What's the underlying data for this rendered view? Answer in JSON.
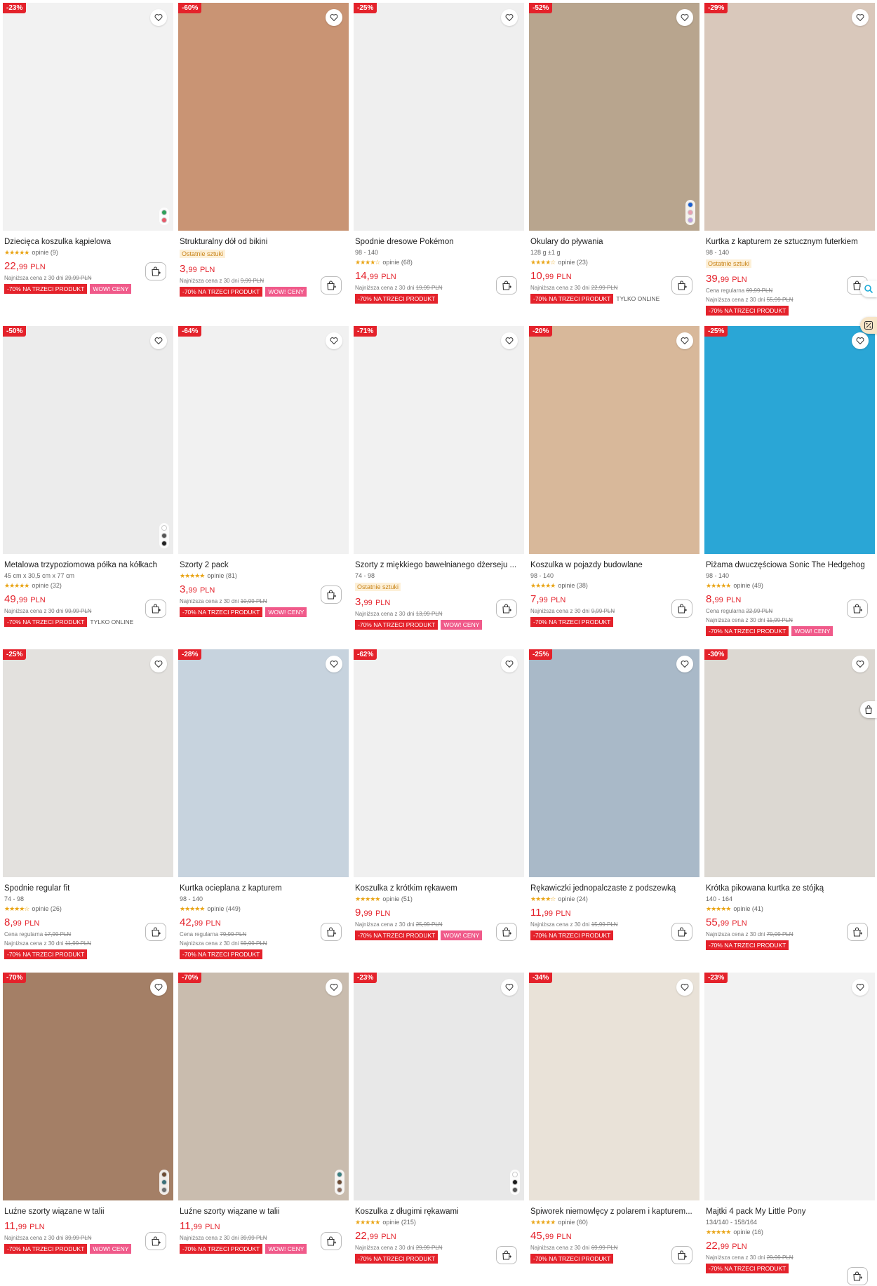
{
  "products": [
    {
      "discount": "-23%",
      "title": "Dziecięca koszulka kąpielowa",
      "sub": "",
      "stars": "★★★★★",
      "reviews": "opinie (9)",
      "last": "",
      "price_main": "22,",
      "price_dec": "99",
      "price_cur": "PLN",
      "reg": "",
      "reg_old": "",
      "low": "Najniższa cena z 30 dni",
      "low_old": "29,99 PLN",
      "badge1": "-70% NA TRZECI PRODUKT",
      "badge2": "WOW! CENY",
      "badge2_type": "pink",
      "bg": "#f2f2f2",
      "swatches": [
        "#2ea05a",
        "#e85a6a"
      ]
    },
    {
      "discount": "-60%",
      "title": "Strukturalny dół od bikini",
      "sub": "",
      "stars": "",
      "reviews": "",
      "last": "Ostatnie sztuki",
      "price_main": "3,",
      "price_dec": "99",
      "price_cur": "PLN",
      "reg": "",
      "reg_old": "",
      "low": "Najniższa cena z 30 dni",
      "low_old": "9,99 PLN",
      "badge1": "-70% NA TRZECI PRODUKT",
      "badge2": "WOW! CENY",
      "badge2_type": "pink",
      "bg": "#c99474",
      "swatches": []
    },
    {
      "discount": "-25%",
      "title": "Spodnie dresowe Pokémon",
      "sub": "98 - 140",
      "stars": "★★★★☆",
      "reviews": "opinie (68)",
      "last": "",
      "price_main": "14,",
      "price_dec": "99",
      "price_cur": "PLN",
      "reg": "",
      "reg_old": "",
      "low": "Najniższa cena z 30 dni",
      "low_old": "19,99 PLN",
      "badge1": "-70% NA TRZECI PRODUKT",
      "badge2": "",
      "badge2_type": "",
      "bg": "#efefef",
      "swatches": []
    },
    {
      "discount": "-52%",
      "title": "Okulary do pływania",
      "sub": "128 g ±1 g",
      "stars": "★★★★☆",
      "reviews": "opinie (23)",
      "last": "",
      "price_main": "10,",
      "price_dec": "99",
      "price_cur": "PLN",
      "reg": "",
      "reg_old": "",
      "low": "Najniższa cena z 30 dni",
      "low_old": "22,99 PLN",
      "badge1": "-70% NA TRZECI PRODUKT",
      "badge2": "TYLKO ONLINE",
      "badge2_type": "text",
      "bg": "#b8a58e",
      "swatches": [
        "#1a5fd0",
        "#e8a0b0",
        "#c0a0e0"
      ]
    },
    {
      "discount": "-29%",
      "title": "Kurtka z kapturem ze sztucznym futerkiem",
      "sub": "98 - 140",
      "stars": "",
      "reviews": "",
      "last": "Ostatnie sztuki",
      "price_main": "39,",
      "price_dec": "99",
      "price_cur": "PLN",
      "reg": "Cena regularna",
      "reg_old": "69,99 PLN",
      "low": "Najniższa cena z 30 dni",
      "low_old": "55,99 PLN",
      "badge1": "-70% NA TRZECI PRODUKT",
      "badge2": "",
      "badge2_type": "",
      "bg": "#d9c8bb",
      "swatches": []
    },
    {
      "discount": "-50%",
      "title": "Metalowa trzypoziomowa półka na kółkach",
      "sub": "45 cm x 30,5 cm x 77 cm",
      "stars": "★★★★★",
      "reviews": "opinie (32)",
      "last": "",
      "price_main": "49,",
      "price_dec": "99",
      "price_cur": "PLN",
      "reg": "",
      "reg_old": "",
      "low": "Najniższa cena z 30 dni",
      "low_old": "99,99 PLN",
      "badge1": "-70% NA TRZECI PRODUKT",
      "badge2": "TYLKO ONLINE",
      "badge2_type": "text",
      "bg": "#ececec",
      "swatches": [
        "#ffffff",
        "#555555",
        "#222222"
      ]
    },
    {
      "discount": "-64%",
      "title": "Szorty 2 pack",
      "sub": "",
      "stars": "★★★★★",
      "reviews": "opinie (81)",
      "last": "",
      "price_main": "3,",
      "price_dec": "99",
      "price_cur": "PLN",
      "reg": "",
      "reg_old": "",
      "low": "Najniższa cena z 30 dni",
      "low_old": "10,99 PLN",
      "badge1": "-70% NA TRZECI PRODUKT",
      "badge2": "WOW! CENY",
      "badge2_type": "pink",
      "bg": "#f1f1f1",
      "swatches": []
    },
    {
      "discount": "-71%",
      "title": "Szorty z miękkiego bawełnianego dżerseju ...",
      "sub": "74 - 98",
      "stars": "",
      "reviews": "",
      "last": "Ostatnie sztuki",
      "price_main": "3,",
      "price_dec": "99",
      "price_cur": "PLN",
      "reg": "",
      "reg_old": "",
      "low": "Najniższa cena z 30 dni",
      "low_old": "13,99 PLN",
      "badge1": "-70% NA TRZECI PRODUKT",
      "badge2": "WOW! CENY",
      "badge2_type": "pink",
      "bg": "#f1f1f1",
      "swatches": []
    },
    {
      "discount": "-20%",
      "title": "Koszulka w pojazdy budowlane",
      "sub": "98 - 140",
      "stars": "★★★★★",
      "reviews": "opinie (38)",
      "last": "",
      "price_main": "7,",
      "price_dec": "99",
      "price_cur": "PLN",
      "reg": "",
      "reg_old": "",
      "low": "Najniższa cena z 30 dni",
      "low_old": "9,99 PLN",
      "badge1": "-70% NA TRZECI PRODUKT",
      "badge2": "",
      "badge2_type": "",
      "bg": "#d8b89a",
      "swatches": []
    },
    {
      "discount": "-25%",
      "title": "Piżama dwuczęściowa Sonic The Hedgehog",
      "sub": "98 - 140",
      "stars": "★★★★★",
      "reviews": "opinie (49)",
      "last": "",
      "price_main": "8,",
      "price_dec": "99",
      "price_cur": "PLN",
      "reg": "Cena regularna",
      "reg_old": "22,99 PLN",
      "low": "Najniższa cena z 30 dni",
      "low_old": "11,99 PLN",
      "badge1": "-70% NA TRZECI PRODUKT",
      "badge2": "WOW! CENY",
      "badge2_type": "pink",
      "bg": "#2aa6d6",
      "swatches": []
    },
    {
      "discount": "-25%",
      "title": "Spodnie regular fit",
      "sub": "74 - 98",
      "stars": "★★★★☆",
      "reviews": "opinie (26)",
      "last": "",
      "price_main": "8,",
      "price_dec": "99",
      "price_cur": "PLN",
      "reg": "Cena regularna",
      "reg_old": "17,99 PLN",
      "low": "Najniższa cena z 30 dni",
      "low_old": "11,99 PLN",
      "badge1": "-70% NA TRZECI PRODUKT",
      "badge2": "",
      "badge2_type": "",
      "bg": "#e3e1de",
      "swatches": []
    },
    {
      "discount": "-28%",
      "title": "Kurtka ocieplana z kapturem",
      "sub": "98 - 140",
      "stars": "★★★★★",
      "reviews": "opinie (449)",
      "last": "",
      "price_main": "42,",
      "price_dec": "99",
      "price_cur": "PLN",
      "reg": "Cena regularna",
      "reg_old": "79,99 PLN",
      "low": "Najniższa cena z 30 dni",
      "low_old": "59,99 PLN",
      "badge1": "-70% NA TRZECI PRODUKT",
      "badge2": "",
      "badge2_type": "",
      "bg": "#c7d3de",
      "swatches": []
    },
    {
      "discount": "-62%",
      "title": "Koszulka z krótkim rękawem",
      "sub": "",
      "stars": "★★★★★",
      "reviews": "opinie (51)",
      "last": "",
      "price_main": "9,",
      "price_dec": "99",
      "price_cur": "PLN",
      "reg": "",
      "reg_old": "",
      "low": "Najniższa cena z 30 dni",
      "low_old": "25,99 PLN",
      "badge1": "-70% NA TRZECI PRODUKT",
      "badge2": "WOW! CENY",
      "badge2_type": "pink",
      "bg": "#f0f0f0",
      "swatches": []
    },
    {
      "discount": "-25%",
      "title": "Rękawiczki jednopalczaste z podszewką",
      "sub": "",
      "stars": "★★★★☆",
      "reviews": "opinie (24)",
      "last": "",
      "price_main": "11,",
      "price_dec": "99",
      "price_cur": "PLN",
      "reg": "",
      "reg_old": "",
      "low": "Najniższa cena z 30 dni",
      "low_old": "15,99 PLN",
      "badge1": "-70% NA TRZECI PRODUKT",
      "badge2": "",
      "badge2_type": "",
      "bg": "#a9b9c8",
      "swatches": []
    },
    {
      "discount": "-30%",
      "title": "Krótka pikowana kurtka ze stójką",
      "sub": "140 - 164",
      "stars": "★★★★★",
      "reviews": "opinie (41)",
      "last": "",
      "price_main": "55,",
      "price_dec": "99",
      "price_cur": "PLN",
      "reg": "",
      "reg_old": "",
      "low": "Najniższa cena z 30 dni",
      "low_old": "79,99 PLN",
      "badge1": "-70% NA TRZECI PRODUKT",
      "badge2": "",
      "badge2_type": "",
      "bg": "#dcd8d2",
      "swatches": []
    },
    {
      "discount": "-70%",
      "title": "Luźne szorty wiązane w talii",
      "sub": "",
      "stars": "",
      "reviews": "",
      "last": "",
      "price_main": "11,",
      "price_dec": "99",
      "price_cur": "PLN",
      "reg": "",
      "reg_old": "",
      "low": "Najniższa cena z 30 dni",
      "low_old": "39,99 PLN",
      "badge1": "-70% NA TRZECI PRODUKT",
      "badge2": "WOW! CENY",
      "badge2_type": "pink",
      "bg": "#a47f66",
      "swatches": [
        "#6b4a32",
        "#3a6f78",
        "#6f6f6f"
      ]
    },
    {
      "discount": "-70%",
      "title": "Luźne szorty wiązane w talii",
      "sub": "",
      "stars": "",
      "reviews": "",
      "last": "",
      "price_main": "11,",
      "price_dec": "99",
      "price_cur": "PLN",
      "reg": "",
      "reg_old": "",
      "low": "Najniższa cena z 30 dni",
      "low_old": "39,99 PLN",
      "badge1": "-70% NA TRZECI PRODUKT",
      "badge2": "WOW! CENY",
      "badge2_type": "pink",
      "bg": "#c9bcae",
      "swatches": [
        "#3a7f80",
        "#6b4a32",
        "#8a6a5a"
      ]
    },
    {
      "discount": "-23%",
      "title": "Koszulka z długimi rękawami",
      "sub": "",
      "stars": "★★★★★",
      "reviews": "opinie (215)",
      "last": "",
      "price_main": "22,",
      "price_dec": "99",
      "price_cur": "PLN",
      "reg": "",
      "reg_old": "",
      "low": "Najniższa cena z 30 dni",
      "low_old": "29,99 PLN",
      "badge1": "-70% NA TRZECI PRODUKT",
      "badge2": "",
      "badge2_type": "",
      "bg": "#e8e8e8",
      "swatches": [
        "#ffffff",
        "#1a1a1a",
        "#555555"
      ]
    },
    {
      "discount": "-34%",
      "title": "Śpiworek niemowlęcy z polarem i kapturem...",
      "sub": "",
      "stars": "★★★★★",
      "reviews": "opinie (60)",
      "last": "",
      "price_main": "45,",
      "price_dec": "99",
      "price_cur": "PLN",
      "reg": "",
      "reg_old": "",
      "low": "Najniższa cena z 30 dni",
      "low_old": "69,99 PLN",
      "badge1": "-70% NA TRZECI PRODUKT",
      "badge2": "",
      "badge2_type": "",
      "bg": "#e9e2d8",
      "swatches": []
    },
    {
      "discount": "-23%",
      "title": "Majtki 4 pack My Little Pony",
      "sub": "134/140 - 158/164",
      "stars": "★★★★★",
      "reviews": "opinie (16)",
      "last": "",
      "price_main": "22,",
      "price_dec": "99",
      "price_cur": "PLN",
      "reg": "",
      "reg_old": "",
      "low": "Najniższa cena z 30 dni",
      "low_old": "29,99 PLN",
      "badge1": "-70% NA TRZECI PRODUKT",
      "badge2": "",
      "badge2_type": "",
      "bg": "#f2f2f2",
      "swatches": []
    }
  ],
  "colors": {
    "accent_red": "#e4222b",
    "wow_pink": "#f05a8a",
    "star": "#e9a415"
  }
}
